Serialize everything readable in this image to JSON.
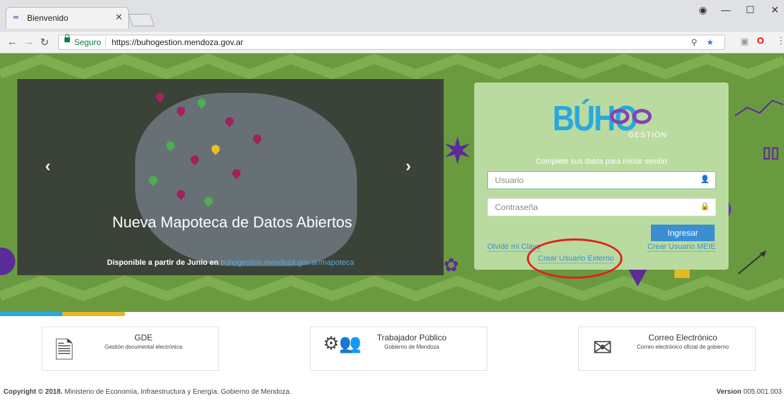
{
  "browser": {
    "tab_title": "Bienvenido",
    "tab_favicon": "∞",
    "secure_label": "Seguro",
    "url": "https://buhogestion.mendoza.gov.ar"
  },
  "carousel": {
    "title": "Nueva Mapoteca de Datos Abiertos",
    "subtitle_prefix": "Disponible a partir de Junio en",
    "subtitle_link": "buhogestion.mendoza.gov.ar/mapoteca",
    "dots": "○●○"
  },
  "login": {
    "logo": "BÚHO",
    "logo_sub": "GESTIÓN",
    "prompt": "Complete sus datos para iniciar sesión",
    "username_placeholder": "Usuario",
    "password_placeholder": "Contraseña",
    "submit_label": "Ingresar",
    "forgot_label": "Olvidé mi Clave",
    "create_meie_label": "Crear Usuario MEIE",
    "create_external_label": "Crear Usuario Externo"
  },
  "services": [
    {
      "title": "GDE",
      "subtitle": "Gestión documental electrónica",
      "icon": "document-icon"
    },
    {
      "title": "Trabajador Público",
      "subtitle": "Gobierno de Mendoza",
      "icon": "people-icon"
    },
    {
      "title": "Correo Electrónico",
      "subtitle": "Correo electrónico oficial de gobierno",
      "icon": "envelope-icon"
    }
  ],
  "footer": {
    "copyright_bold": "Copyright © 2018.",
    "copyright_text": " Ministerio de Economía, Infraestructura y Energía. Gobierno de Mendoza.",
    "version_label": "Version",
    "version_value": " 005.001.003"
  },
  "colors": {
    "hero_bg": "#6a9a3f",
    "login_bg": "#b9dba0",
    "accent_blue": "#3a8fd1",
    "highlight_red": "#e02020"
  }
}
